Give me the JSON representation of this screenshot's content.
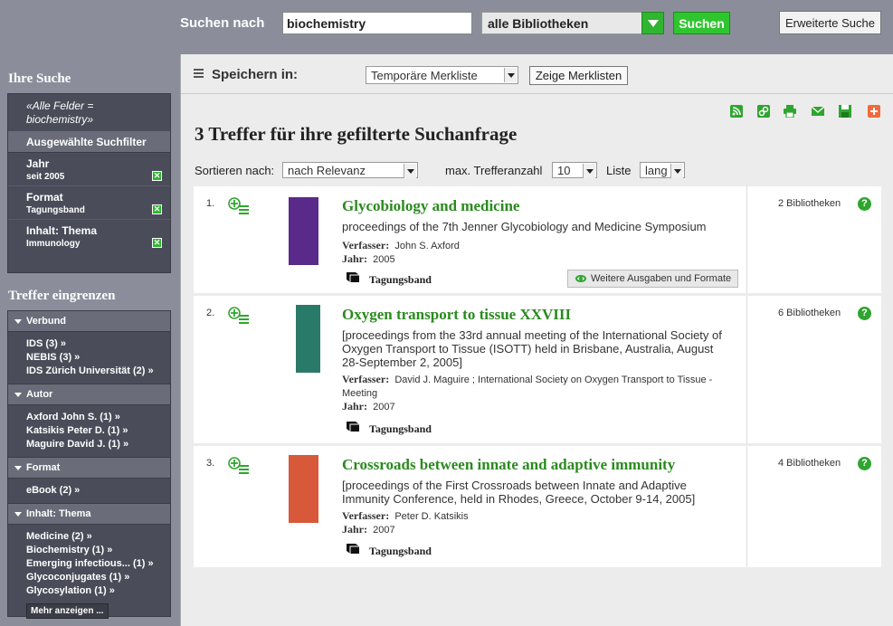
{
  "search": {
    "label": "Suchen nach",
    "query": "biochemistry",
    "scope": "alle Bibliotheken",
    "submit": "Suchen",
    "advanced": "Erweiterte Suche"
  },
  "sidebar": {
    "your_search_heading": "Ihre Suche",
    "query_line1": "«Alle Felder =",
    "query_line2": "biochemistry»",
    "filters_heading": "Ausgewählte Suchfilter",
    "filters": [
      {
        "title": "Jahr",
        "value": "seit 2005"
      },
      {
        "title": "Format",
        "value": "Tagungsband"
      },
      {
        "title": "Inhalt: Thema",
        "value": "Immunology"
      }
    ],
    "narrow_heading": "Treffer eingrenzen",
    "facets": [
      {
        "name": "Verbund",
        "items": [
          "IDS  (3) »",
          "NEBIS  (3) »",
          "IDS Zürich Universität  (2) »"
        ]
      },
      {
        "name": "Autor",
        "items": [
          "Axford John S.  (1) »",
          "Katsikis Peter D.  (1) »",
          "Maguire David J.  (1) »"
        ]
      },
      {
        "name": "Format",
        "items": [
          "eBook  (2) »"
        ]
      },
      {
        "name": "Inhalt: Thema",
        "items": [
          "Medicine  (2) »",
          "Biochemistry  (1) »",
          "Emerging infectious...  (1) »",
          "Glycoconjugates  (1) »",
          "Glycosylation  (1) »"
        ]
      }
    ],
    "show_more": "Mehr anzeigen ..."
  },
  "savebar": {
    "label": "Speichern in:",
    "list": "Temporäre Merkliste",
    "show_lists": "Zeige Merklisten"
  },
  "tools": [
    "rss-icon",
    "link-icon",
    "print-icon",
    "mail-icon",
    "save-icon",
    "add-icon"
  ],
  "results_title": "3 Treffer für ihre gefilterte Suchanfrage",
  "sort": {
    "label": "Sortieren nach:",
    "value": "nach Relevanz",
    "max_label": "max. Trefferanzahl",
    "max_value": "10",
    "list_label": "Liste",
    "list_value": "lang"
  },
  "results": [
    {
      "num": "1.",
      "title": "Glycobiology and medicine",
      "subtitle": "proceedings of the 7th Jenner Glycobiology and Medicine Symposium",
      "author_label": "Verfasser:",
      "author": "John S. Axford",
      "year_label": "Jahr:",
      "year": "2005",
      "type": "Tagungsband",
      "libraries": "2  Bibliotheken",
      "more_formats": "Weitere Ausgaben und Formate",
      "cover_color": "#5a2a8a"
    },
    {
      "num": "2.",
      "title": "Oxygen transport to tissue XXVIII",
      "subtitle": "[proceedings from the 33rd annual meeting of the International Society of Oxygen Transport to Tissue (ISOTT) held in Brisbane, Australia, August 28-September 2, 2005]",
      "author_label": "Verfasser:",
      "author": "David J. Maguire ; International Society on Oxygen Transport to Tissue - Meeting",
      "year_label": "Jahr:",
      "year": "2007",
      "type": "Tagungsband",
      "libraries": "6  Bibliotheken",
      "cover_color": "#2a7a6a"
    },
    {
      "num": "3.",
      "title": "Crossroads between innate and adaptive immunity",
      "subtitle": "[proceedings of the First Crossroads between Innate and Adaptive Immunity Conference, held in Rhodes, Greece, October 9-14, 2005]",
      "author_label": "Verfasser:",
      "author": "Peter D. Katsikis",
      "year_label": "Jahr:",
      "year": "2007",
      "type": "Tagungsband",
      "libraries": "4  Bibliotheken",
      "cover_color": "#d8583a"
    }
  ],
  "help_glyph": "?"
}
